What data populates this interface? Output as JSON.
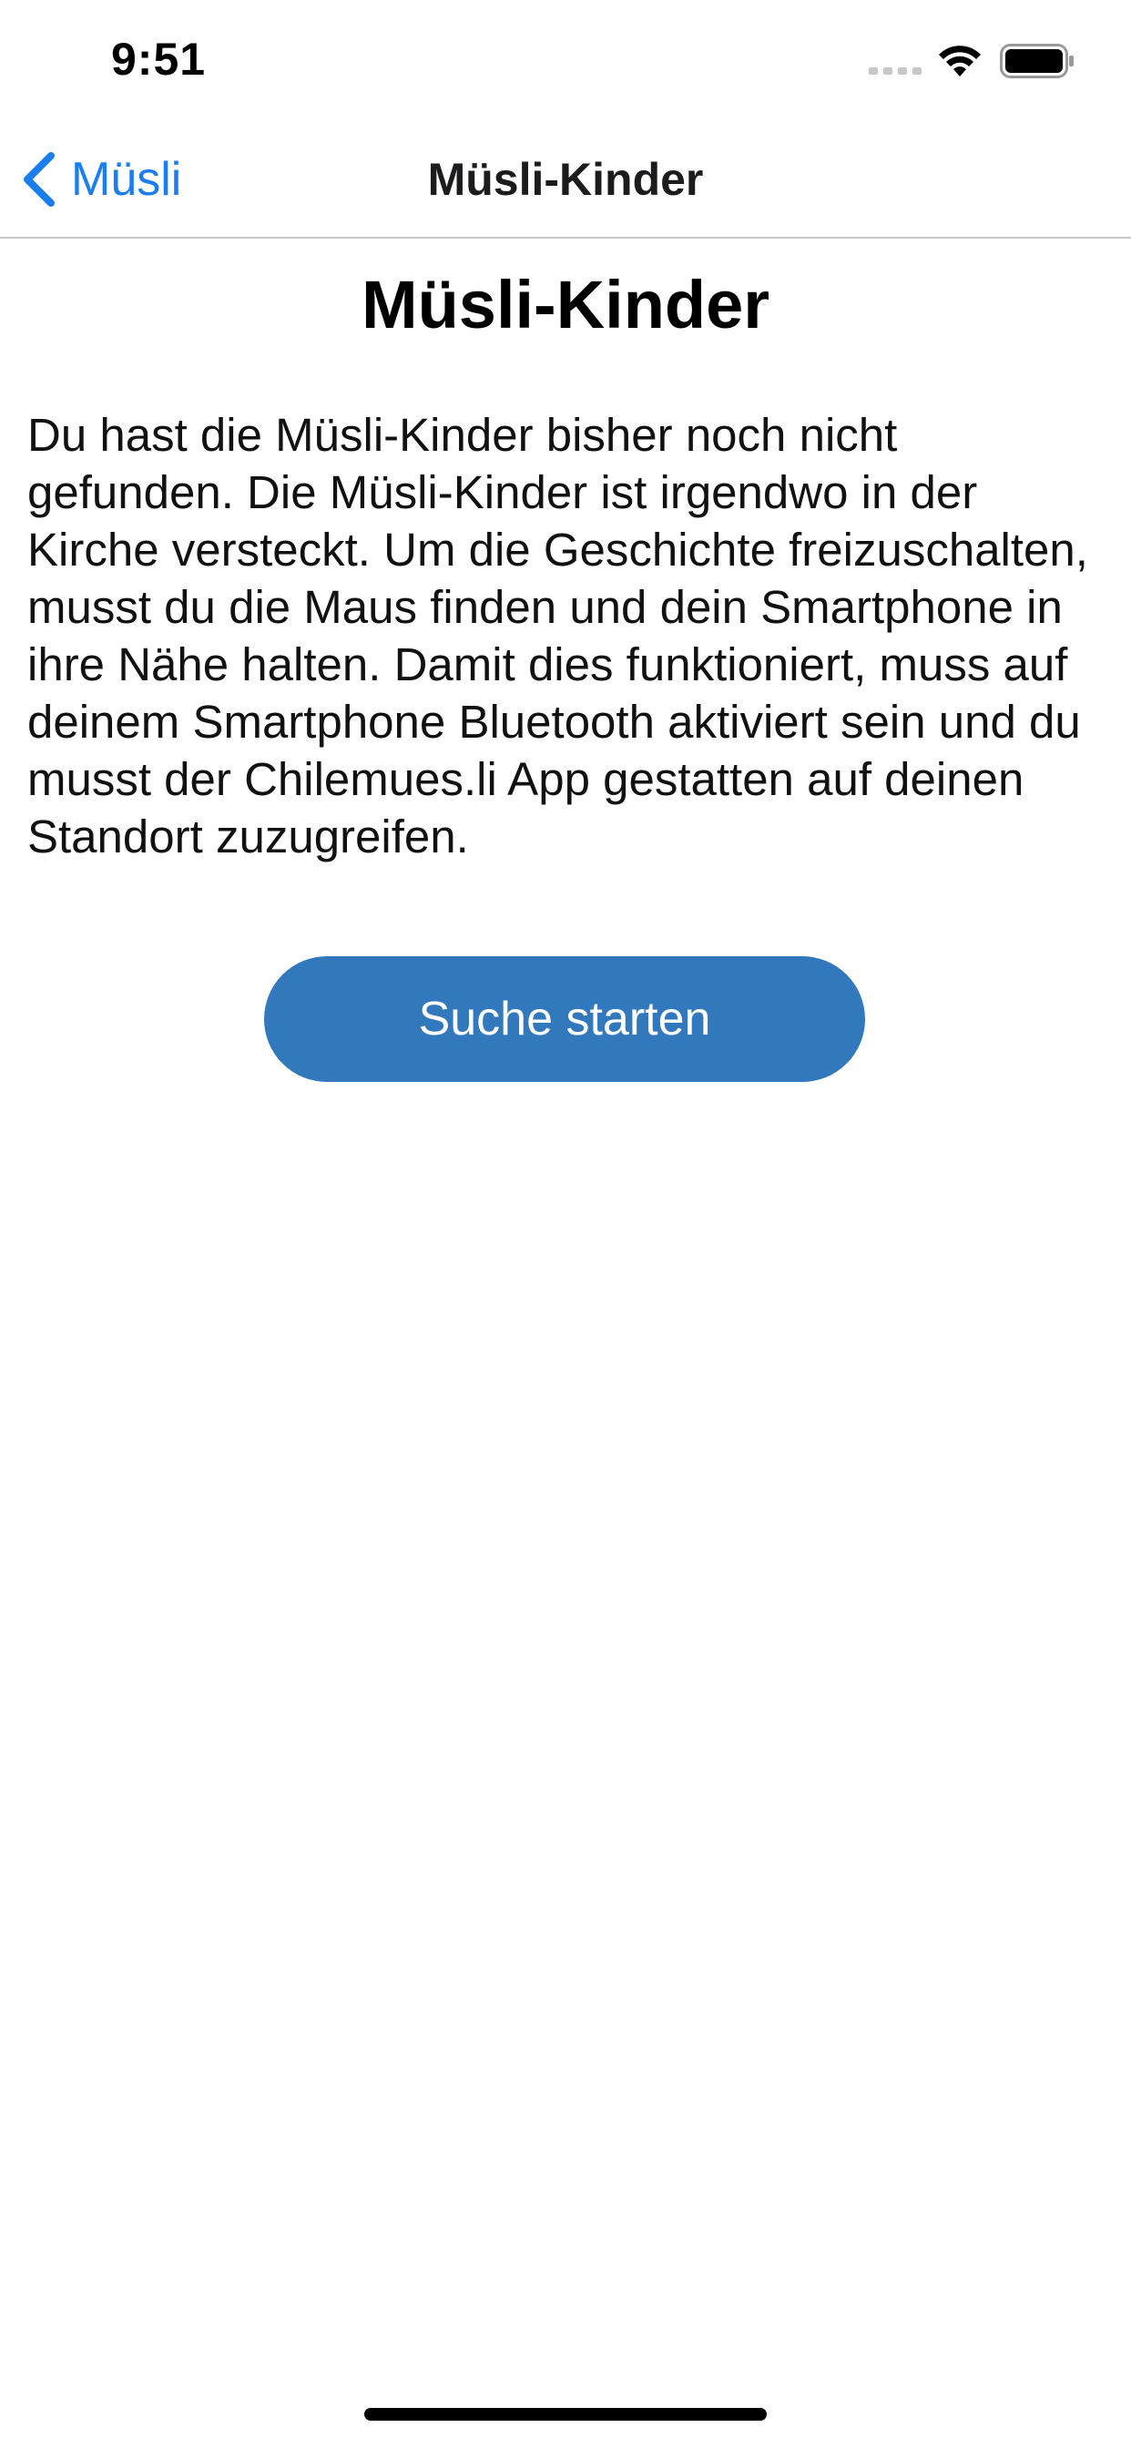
{
  "status_bar": {
    "time": "9:51"
  },
  "nav": {
    "back_label": "Müsli",
    "title": "Müsli-Kinder"
  },
  "main": {
    "title": "Müsli-Kinder",
    "description": "Du hast die Müsli-Kinder bisher noch nicht gefunden. Die Müsli-Kinder ist irgendwo in der Kirche versteckt. Um die Geschichte freizuschalten, musst du die Maus finden und dein Smartphone in ihre Nähe halten. Damit dies funktioniert, muss auf deinem Smartphone Bluetooth aktiviert sein und du musst der Chilemues.li App gestatten auf deinen Standort zuzugreifen.",
    "button_label": "Suche starten"
  },
  "colors": {
    "accent": "#1a7df0",
    "button": "#3278bd"
  },
  "icons": {
    "back": "chevron-left-icon",
    "signal": "cellular-signal-icon",
    "wifi": "wifi-icon",
    "battery": "battery-icon"
  }
}
